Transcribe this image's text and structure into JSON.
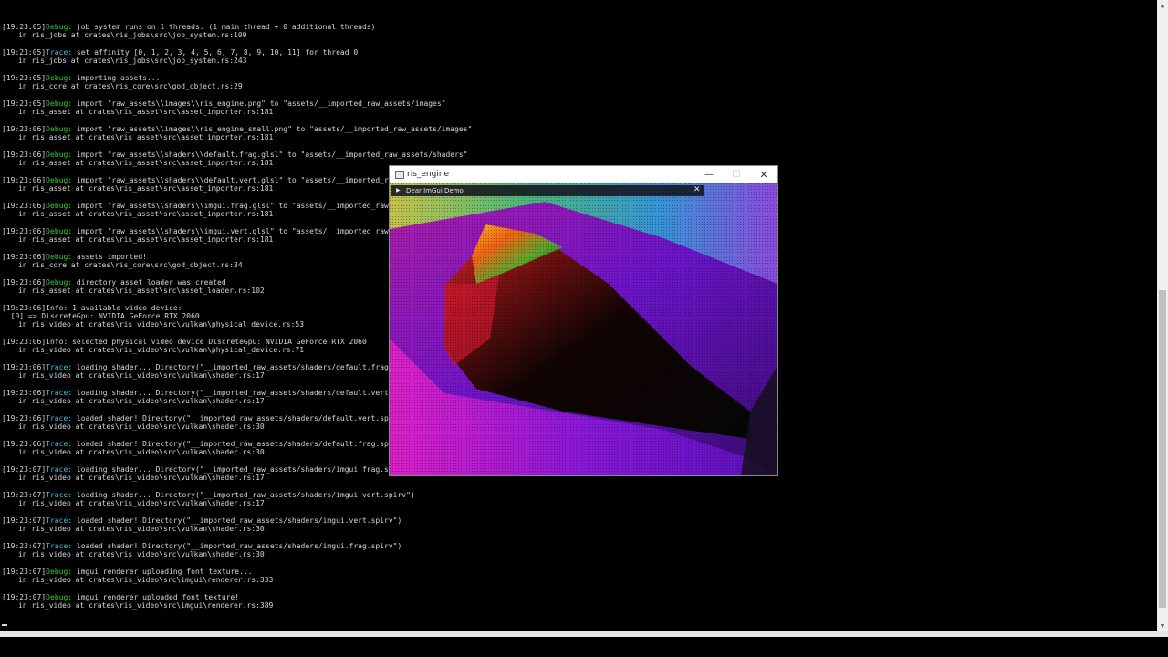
{
  "console": {
    "entries": [
      {
        "time": "[19:23:05]",
        "level": "Debug:",
        "cls": "lvl-debug",
        "msg": " job system runs on 1 threads. (1 main thread + 0 additional threads)",
        "loc": "in ris_jobs at crates\\ris_jobs\\src\\job_system.rs:109"
      },
      {
        "time": "[19:23:05]",
        "level": "Trace:",
        "cls": "lvl-trace",
        "msg": " set affinity [0, 1, 2, 3, 4, 5, 6, 7, 8, 9, 10, 11] for thread 0",
        "loc": "in ris_jobs at crates\\ris_jobs\\src\\job_system.rs:243"
      },
      {
        "time": "[19:23:05]",
        "level": "Debug:",
        "cls": "lvl-debug",
        "msg": " importing assets...",
        "loc": "in ris_core at crates\\ris_core\\src\\god_object.rs:29"
      },
      {
        "time": "[19:23:05]",
        "level": "Debug:",
        "cls": "lvl-debug",
        "msg": " import \"raw_assets\\\\images\\\\ris_engine.png\" to \"assets/__imported_raw_assets/images\"",
        "loc": "in ris_asset at crates\\ris_asset\\src\\asset_importer.rs:181"
      },
      {
        "time": "[19:23:06]",
        "level": "Debug:",
        "cls": "lvl-debug",
        "msg": " import \"raw_assets\\\\images\\\\ris_engine_small.png\" to \"assets/__imported_raw_assets/images\"",
        "loc": "in ris_asset at crates\\ris_asset\\src\\asset_importer.rs:181"
      },
      {
        "time": "[19:23:06]",
        "level": "Debug:",
        "cls": "lvl-debug",
        "msg": " import \"raw_assets\\\\shaders\\\\default.frag.glsl\" to \"assets/__imported_raw_assets/shaders\"",
        "loc": "in ris_asset at crates\\ris_asset\\src\\asset_importer.rs:181"
      },
      {
        "time": "[19:23:06]",
        "level": "Debug:",
        "cls": "lvl-debug",
        "msg": " import \"raw_assets\\\\shaders\\\\default.vert.glsl\" to \"assets/__imported_raw_assets/shaders\"",
        "loc": "in ris_asset at crates\\ris_asset\\src\\asset_importer.rs:181"
      },
      {
        "time": "[19:23:06]",
        "level": "Debug:",
        "cls": "lvl-debug",
        "msg": " import \"raw_assets\\\\shaders\\\\imgui.frag.glsl\" to \"assets/__imported_raw_assets/shaders\"",
        "loc": "in ris_asset at crates\\ris_asset\\src\\asset_importer.rs:181"
      },
      {
        "time": "[19:23:06]",
        "level": "Debug:",
        "cls": "lvl-debug",
        "msg": " import \"raw_assets\\\\shaders\\\\imgui.vert.glsl\" to \"assets/__imported_raw_assets/shaders\"",
        "loc": "in ris_asset at crates\\ris_asset\\src\\asset_importer.rs:181"
      },
      {
        "time": "[19:23:06]",
        "level": "Debug:",
        "cls": "lvl-debug",
        "msg": " assets imported!",
        "loc": "in ris_core at crates\\ris_core\\src\\god_object.rs:34"
      },
      {
        "time": "[19:23:06]",
        "level": "Debug:",
        "cls": "lvl-debug",
        "msg": " directory asset loader was created",
        "loc": "in ris_asset at crates\\ris_asset\\src\\asset_loader.rs:102"
      },
      {
        "time": "[19:23:06]",
        "level": "Info:",
        "cls": "lvl-info",
        "msg": " 1 available video device:\n  [0] => DiscreteGpu: NVIDIA GeForce RTX 2060",
        "loc": "in ris_video at crates\\ris_video\\src\\vulkan\\physical_device.rs:53"
      },
      {
        "time": "[19:23:06]",
        "level": "Info:",
        "cls": "lvl-info",
        "msg": " selected physical video device DiscreteGpu: NVIDIA GeForce RTX 2060",
        "loc": "in ris_video at crates\\ris_video\\src\\vulkan\\physical_device.rs:71"
      },
      {
        "time": "[19:23:06]",
        "level": "Trace:",
        "cls": "lvl-trace",
        "msg": " loading shader... Directory(\"__imported_raw_assets/shaders/default.frag.spirv\")",
        "loc": "in ris_video at crates\\ris_video\\src\\vulkan\\shader.rs:17"
      },
      {
        "time": "[19:23:06]",
        "level": "Trace:",
        "cls": "lvl-trace",
        "msg": " loading shader... Directory(\"__imported_raw_assets/shaders/default.vert.spirv\")",
        "loc": "in ris_video at crates\\ris_video\\src\\vulkan\\shader.rs:17"
      },
      {
        "time": "[19:23:06]",
        "level": "Trace:",
        "cls": "lvl-trace",
        "msg": " loaded shader! Directory(\"__imported_raw_assets/shaders/default.vert.spirv\")",
        "loc": "in ris_video at crates\\ris_video\\src\\vulkan\\shader.rs:30"
      },
      {
        "time": "[19:23:06]",
        "level": "Trace:",
        "cls": "lvl-trace",
        "msg": " loaded shader! Directory(\"__imported_raw_assets/shaders/default.frag.spirv\")",
        "loc": "in ris_video at crates\\ris_video\\src\\vulkan\\shader.rs:30"
      },
      {
        "time": "[19:23:07]",
        "level": "Trace:",
        "cls": "lvl-trace",
        "msg": " loading shader... Directory(\"__imported_raw_assets/shaders/imgui.frag.spirv\")",
        "loc": "in ris_video at crates\\ris_video\\src\\vulkan\\shader.rs:17"
      },
      {
        "time": "[19:23:07]",
        "level": "Trace:",
        "cls": "lvl-trace",
        "msg": " loading shader... Directory(\"__imported_raw_assets/shaders/imgui.vert.spirv\")",
        "loc": "in ris_video at crates\\ris_video\\src\\vulkan\\shader.rs:17"
      },
      {
        "time": "[19:23:07]",
        "level": "Trace:",
        "cls": "lvl-trace",
        "msg": " loaded shader! Directory(\"__imported_raw_assets/shaders/imgui.vert.spirv\")",
        "loc": "in ris_video at crates\\ris_video\\src\\vulkan\\shader.rs:30"
      },
      {
        "time": "[19:23:07]",
        "level": "Trace:",
        "cls": "lvl-trace",
        "msg": " loaded shader! Directory(\"__imported_raw_assets/shaders/imgui.frag.spirv\")",
        "loc": "in ris_video at crates\\ris_video\\src\\vulkan\\shader.rs:30"
      },
      {
        "time": "[19:23:07]",
        "level": "Debug:",
        "cls": "lvl-debug",
        "msg": " imgui renderer uploading font texture...",
        "loc": "in ris_video at crates\\ris_video\\src\\imgui\\renderer.rs:333"
      },
      {
        "time": "[19:23:07]",
        "level": "Debug:",
        "cls": "lvl-debug",
        "msg": " imgui renderer uploaded font texture!",
        "loc": "in ris_video at crates\\ris_video\\src\\imgui\\renderer.rs:389"
      }
    ]
  },
  "window": {
    "title": "ris_engine",
    "minimize_glyph": "—",
    "maximize_glyph": "☐",
    "close_glyph": "✕",
    "icon": "app-window-icon"
  },
  "imgui": {
    "collapse_glyph": "▶",
    "title": "Dear ImGui Demo",
    "close_glyph": "✕"
  },
  "scrollbar": {
    "up_glyph": "▲",
    "down_glyph": "▼"
  },
  "colors": {
    "debug": "#33cc33",
    "trace": "#3cc0e0",
    "info": "#d6d6d6",
    "console_bg": "#000000"
  }
}
